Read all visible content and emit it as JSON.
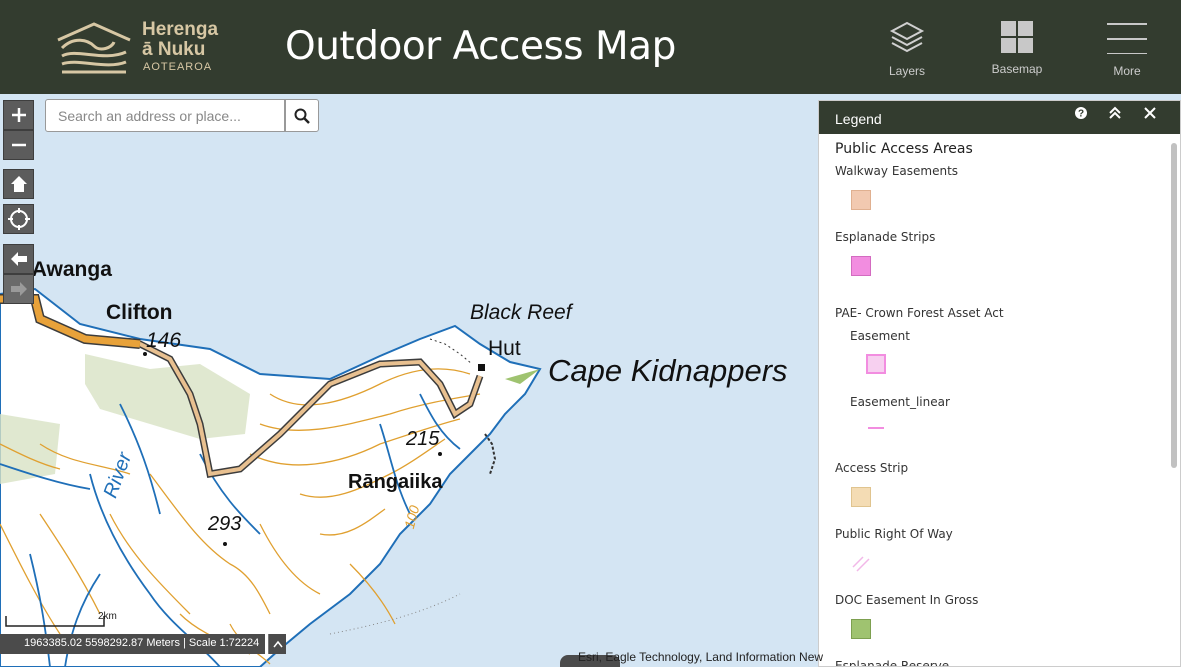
{
  "header": {
    "logo_line1": "Herenga",
    "logo_line2": "ā Nuku",
    "logo_line3": "AOTEAROA",
    "title": "Outdoor Access Map",
    "buttons": {
      "layers": "Layers",
      "basemap": "Basemap",
      "more": "More"
    },
    "bg_color": "#333c2f"
  },
  "search": {
    "placeholder": "Search an address or place..."
  },
  "map": {
    "labels": {
      "awanga": "e Awanga",
      "clifton": "Clifton",
      "h146": "146",
      "black_reef": "Black Reef",
      "hut": "Hut",
      "cape": "Cape Kidnappers",
      "h215": "215",
      "rangaiika": "Rāngaiika",
      "h293": "293",
      "river": "River",
      "h100": "100"
    },
    "water_color": "#d4e5f3",
    "land_color": "#ffffff",
    "contour_color": "#e0a030",
    "stream_color": "#1f6fb8"
  },
  "legend": {
    "title": "Legend",
    "section": "Public Access Areas",
    "items": [
      {
        "label": "Walkway Easements",
        "color": "#f2c9b0"
      },
      {
        "label": "Esplanade Strips",
        "color": "#f28de0"
      },
      {
        "label": "PAE- Crown Forest Asset Act",
        "color": ""
      },
      {
        "label": "Easement",
        "color": "#f7d0f0"
      },
      {
        "label": "Easement_linear",
        "color": "#f28de0"
      },
      {
        "label": "Access Strip",
        "color": "#f4dcb4"
      },
      {
        "label": "Public Right Of Way",
        "color": "#f28de0"
      },
      {
        "label": "DOC Easement In Gross",
        "color": "#9fc370"
      },
      {
        "label": "Esplanade Reserve",
        "color": ""
      }
    ]
  },
  "status": {
    "coords": "1963385.02 5598292.87 Meters | Scale 1:72224",
    "scale_label": "2km",
    "attribution": "Esri, Eagle Technology, Land Information New"
  }
}
